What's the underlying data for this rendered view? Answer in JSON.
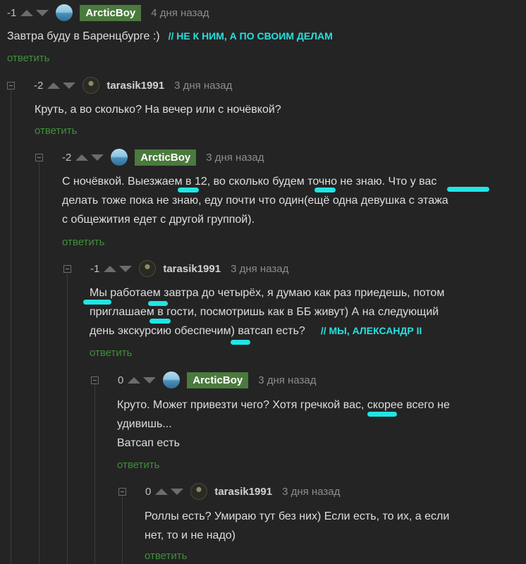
{
  "comments": [
    {
      "rating": "-1",
      "user": "ArcticBoy",
      "time": "4 дня назад",
      "lines": [
        "Завтра буду в Баренцбурге :)"
      ],
      "note": "// НЕ К НИМ, А ПО СВОИМ ДЕЛАМ",
      "reply": "ответить"
    },
    {
      "rating": "-2",
      "user": "tarasik1991",
      "time": "3 дня назад",
      "lines": [
        "Круть, а во сколько? На вечер или с ночёвкой?"
      ],
      "reply": "ответить"
    },
    {
      "rating": "-2",
      "user": "ArcticBoy",
      "time": "3 дня назад",
      "lines": [
        "С ночёвкой. Выезжаем в 12, во сколько будем точно не знаю. Что у вас",
        "делать тоже пока не знаю, еду почти что один(ещё одна девушка с этажа",
        "с общежития едет с другой группой)."
      ],
      "reply": "ответить"
    },
    {
      "rating": "-1",
      "user": "tarasik1991",
      "time": "3 дня назад",
      "lines": [
        "Мы работаем завтра до четырёх, я думаю как раз приедешь, потом",
        "приглашаем в гости, посмотришь как в ББ живут) А на следующий",
        "день экскурсию обеспечим) ватсап есть?"
      ],
      "note": "// МЫ, АЛЕКСАНДР II",
      "reply": "ответить"
    },
    {
      "rating": "0",
      "user": "ArcticBoy",
      "time": "3 дня назад",
      "lines": [
        "Круто. Может привезти чего? Хотя гречкой вас, скорее всего не",
        "удивишь...",
        "Ватсап есть"
      ],
      "reply": "ответить"
    },
    {
      "rating": "0",
      "user": "tarasik1991",
      "time": "3 дня назад",
      "lines": [
        "Роллы есть? Умираю тут без них) Если есть, то их, а если",
        "нет, то и не надо)"
      ],
      "reply": "ответить"
    }
  ]
}
